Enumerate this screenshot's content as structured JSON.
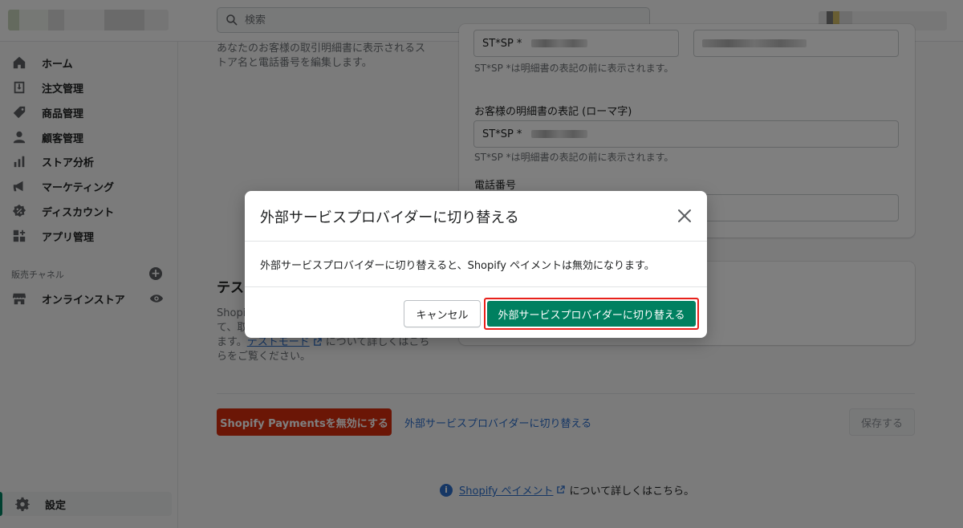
{
  "topbar": {
    "search_placeholder": "検索"
  },
  "sidebar": {
    "items": [
      {
        "label": "ホーム",
        "icon": "home-icon"
      },
      {
        "label": "注文管理",
        "icon": "orders-icon"
      },
      {
        "label": "商品管理",
        "icon": "tag-icon"
      },
      {
        "label": "顧客管理",
        "icon": "customer-icon"
      },
      {
        "label": "ストア分析",
        "icon": "analytics-icon"
      },
      {
        "label": "マーケティング",
        "icon": "marketing-icon"
      },
      {
        "label": "ディスカウント",
        "icon": "discount-icon"
      },
      {
        "label": "アプリ管理",
        "icon": "apps-icon"
      }
    ],
    "channels_heading": "販売チャネル",
    "online_store": "オンラインストア",
    "settings": "設定"
  },
  "statement": {
    "description": "あなたのお客様の取引明細書に表示されるストア名と電話番号を編集します。",
    "field1_prefix": "ST*SP *",
    "field1_helper": "ST*SP *は明細書の表記の前に表示されます。",
    "field2_label": "お客様の明細書の表記 (ローマ字)",
    "field2_prefix": "ST*SP *",
    "field2_helper": "ST*SP *は明細書の表記の前に表示されます。",
    "phone_label": "電話番号"
  },
  "test_mode": {
    "title": "テスト",
    "desc_part1": "Shopify",
    "desc_part2": "て、取",
    "desc_part3": "ます。",
    "link": "テストモード",
    "desc_part4": "について詳しくはこち",
    "desc_part5": "らをご覧ください。"
  },
  "actions": {
    "disable_button": "Shopify Paymentsを無効にする",
    "switch_link": "外部サービスプロバイダーに切り替える",
    "save_button": "保存する"
  },
  "footer": {
    "link": "Shopify ペイメント",
    "text": "について詳しくはこちら。"
  },
  "modal": {
    "title": "外部サービスプロバイダーに切り替える",
    "body": "外部サービスプロバイダーに切り替えると、Shopify ペイメントは無効になります。",
    "cancel_label": "キャンセル",
    "confirm_label": "外部サービスプロバイダーに切り替える"
  },
  "colors": {
    "primary": "#008060",
    "critical": "#d72c0d",
    "link": "#2c6ecb",
    "highlight": "#e8211b"
  }
}
